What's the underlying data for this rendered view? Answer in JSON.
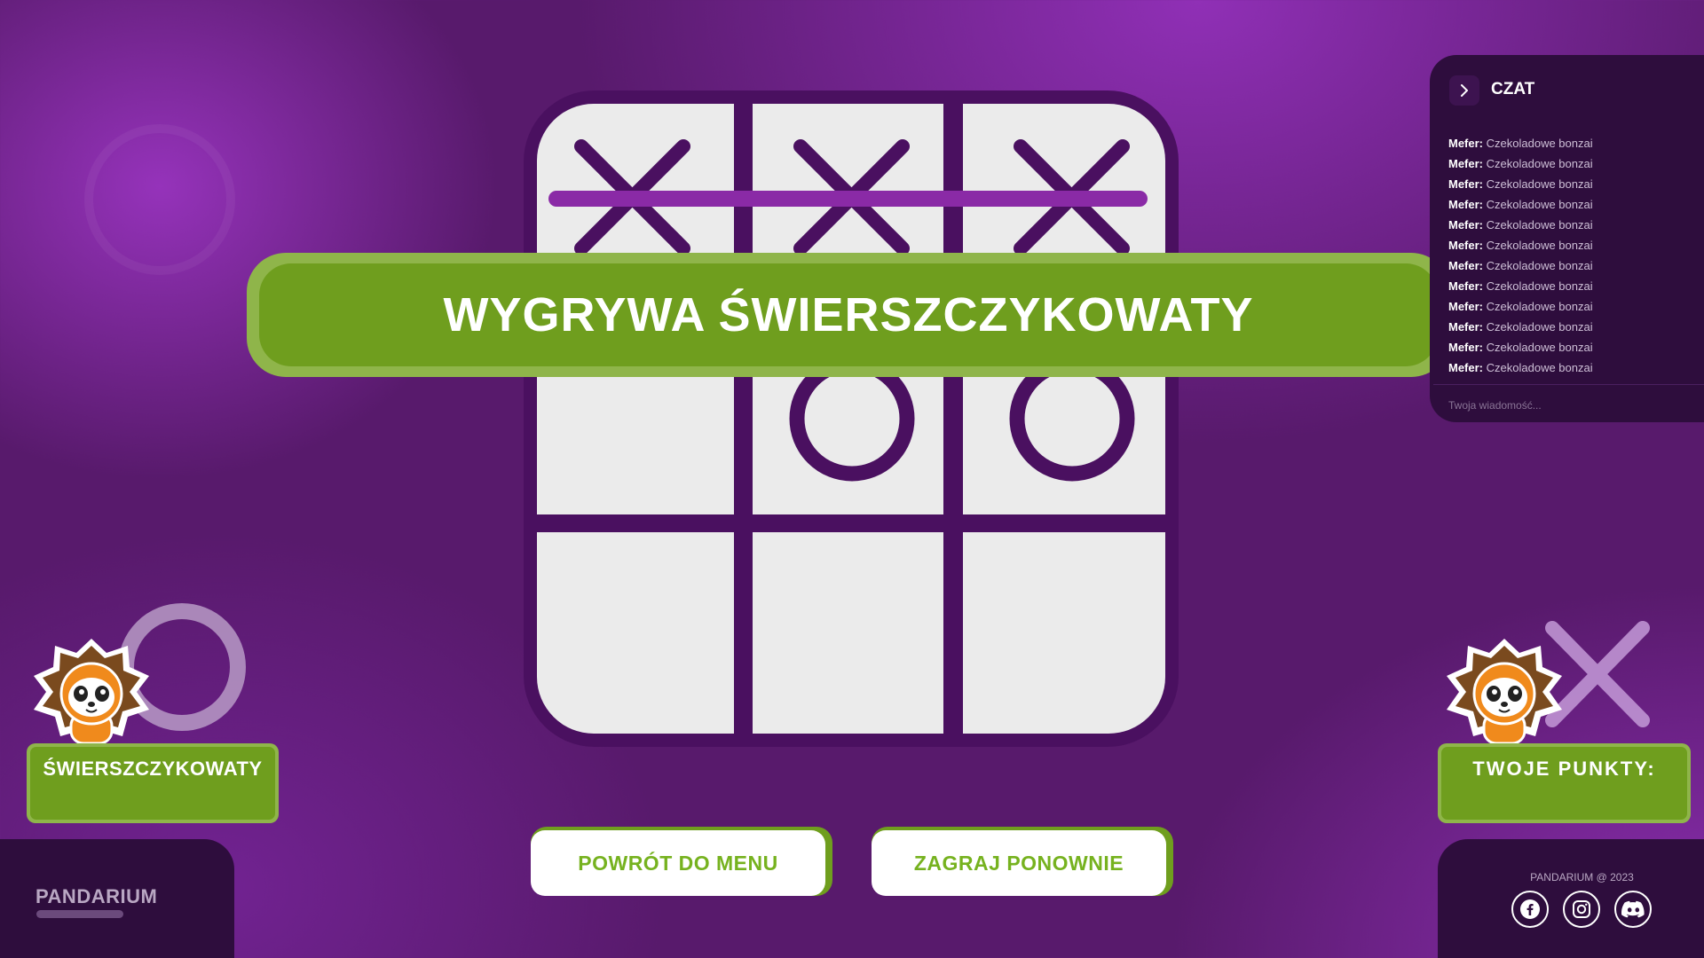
{
  "winner_banner": "WYGRYWA ŚWIERSZCZYKOWATY",
  "board": {
    "cells": [
      "X",
      "X",
      "X",
      "",
      "O",
      "O",
      "",
      "",
      ""
    ],
    "winning_line": "top-row"
  },
  "chat": {
    "title": "CZAT",
    "toggle_icon": "chevron-right-icon",
    "messages": [
      {
        "author": "Mefer:",
        "text": "Czekoladowe bonzai"
      },
      {
        "author": "Mefer:",
        "text": "Czekoladowe bonzai"
      },
      {
        "author": "Mefer:",
        "text": "Czekoladowe bonzai"
      },
      {
        "author": "Mefer:",
        "text": "Czekoladowe bonzai"
      },
      {
        "author": "Mefer:",
        "text": "Czekoladowe bonzai"
      },
      {
        "author": "Mefer:",
        "text": "Czekoladowe bonzai"
      },
      {
        "author": "Mefer:",
        "text": "Czekoladowe bonzai"
      },
      {
        "author": "Mefer:",
        "text": "Czekoladowe bonzai"
      },
      {
        "author": "Mefer:",
        "text": "Czekoladowe bonzai"
      },
      {
        "author": "Mefer:",
        "text": "Czekoladowe bonzai"
      },
      {
        "author": "Mefer:",
        "text": "Czekoladowe bonzai"
      },
      {
        "author": "Mefer:",
        "text": "Czekoladowe bonzai"
      }
    ],
    "input_placeholder": "Twoja wiadomość..."
  },
  "players": {
    "left": {
      "name": "ŚWIERSZCZYKOWATY",
      "symbol": "O",
      "avatar": "lion-panda-mascot"
    },
    "right": {
      "label": "TWOJE PUNKTY:",
      "symbol": "X",
      "avatar": "lion-panda-mascot"
    }
  },
  "buttons": {
    "menu": "POWRÓT DO MENU",
    "replay": "ZAGRAJ PONOWNIE"
  },
  "footer": {
    "logo": "PANDARIUM",
    "copyright": "PANDARIUM @ 2023",
    "socials": [
      "facebook-icon",
      "instagram-icon",
      "discord-icon"
    ]
  },
  "colors": {
    "background": "#581a6c",
    "board_frame": "#4a1060",
    "cell": "#ebebeb",
    "accent_green": "#6f9e1e",
    "winline": "#8a2aa6",
    "panel": "#2e0d3d"
  }
}
